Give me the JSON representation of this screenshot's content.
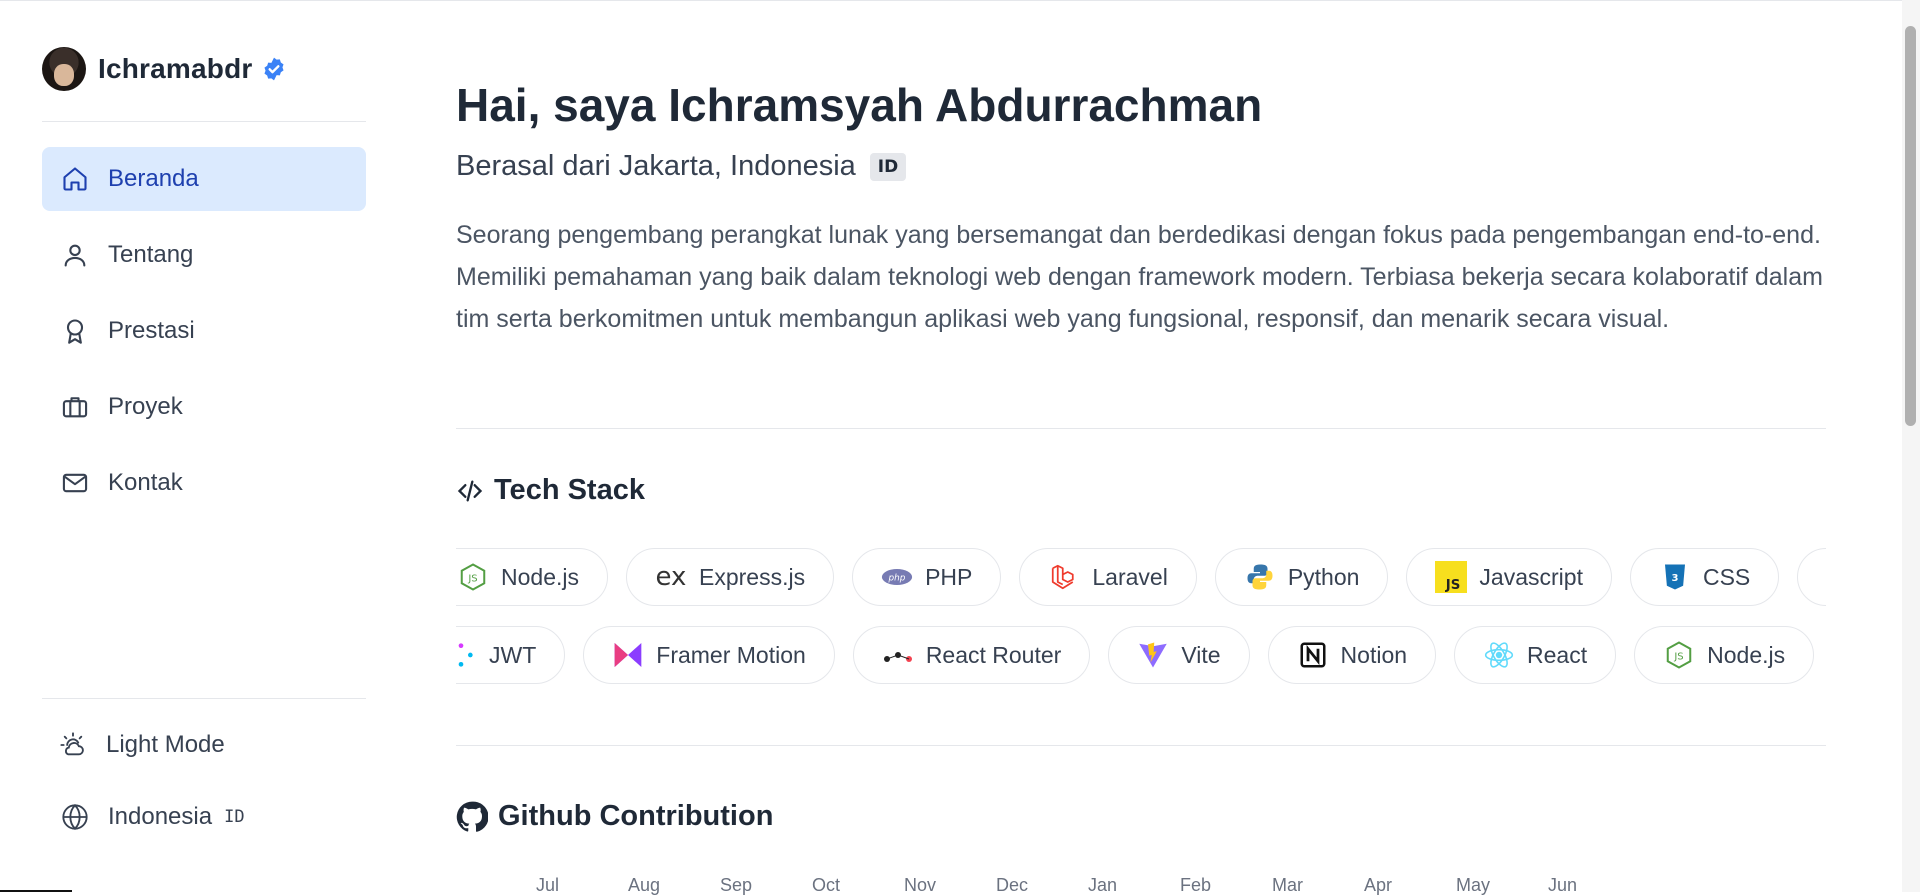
{
  "profile": {
    "name": "Ichramabdr"
  },
  "nav": {
    "items": [
      {
        "label": "Beranda",
        "icon": "home-icon",
        "active": true
      },
      {
        "label": "Tentang",
        "icon": "user-icon",
        "active": false
      },
      {
        "label": "Prestasi",
        "icon": "award-icon",
        "active": false
      },
      {
        "label": "Proyek",
        "icon": "briefcase-icon",
        "active": false
      },
      {
        "label": "Kontak",
        "icon": "mail-icon",
        "active": false
      }
    ]
  },
  "settings": {
    "theme_label": "Light Mode",
    "language_label": "Indonesia",
    "language_code": "ID"
  },
  "hero": {
    "title": "Hai, saya Ichramsyah Abdurrachman",
    "subtitle": "Berasal dari Jakarta, Indonesia",
    "flag_code": "ID",
    "description": "Seorang pengembang perangkat lunak yang bersemangat dan berdedikasi dengan fokus pada pengembangan end-to-end. Memiliki pemahaman yang baik dalam teknologi web dengan framework modern. Terbiasa bekerja secara kolaboratif dalam tim serta berkomitmen untuk membangun aplikasi web yang fungsional, responsif, dan menarik secara visual."
  },
  "tech_stack": {
    "title": "Tech Stack",
    "row1": [
      {
        "label": "Node.js",
        "icon": "nodejs-icon"
      },
      {
        "label": "Express.js",
        "icon": "express-icon"
      },
      {
        "label": "PHP",
        "icon": "php-icon"
      },
      {
        "label": "Laravel",
        "icon": "laravel-icon"
      },
      {
        "label": "Python",
        "icon": "python-icon"
      },
      {
        "label": "Javascript",
        "icon": "javascript-icon"
      },
      {
        "label": "CSS",
        "icon": "css-icon"
      }
    ],
    "row2": [
      {
        "label": "JWT",
        "icon": "jwt-icon"
      },
      {
        "label": "Framer Motion",
        "icon": "framer-motion-icon"
      },
      {
        "label": "React Router",
        "icon": "react-router-icon"
      },
      {
        "label": "Vite",
        "icon": "vite-icon"
      },
      {
        "label": "Notion",
        "icon": "notion-icon"
      },
      {
        "label": "React",
        "icon": "react-icon"
      },
      {
        "label": "Node.js",
        "icon": "nodejs-icon"
      }
    ]
  },
  "github": {
    "title": "Github Contribution",
    "months": [
      "Jul",
      "Aug",
      "Sep",
      "Oct",
      "Nov",
      "Dec",
      "Jan",
      "Feb",
      "Mar",
      "Apr",
      "May",
      "Jun"
    ]
  },
  "colors": {
    "accent": "#1e40af",
    "active_bg": "#dbeafe",
    "verified": "#3b82f6"
  }
}
